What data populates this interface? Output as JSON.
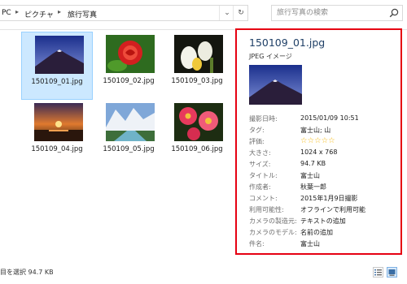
{
  "address_bar": {
    "crumbs": [
      "PC",
      "ピクチャ",
      "旅行写真"
    ],
    "separator": "▸",
    "dropdown_glyph": "⌄",
    "refresh_glyph": "↻"
  },
  "search": {
    "placeholder": "旅行写真の検索",
    "icon": "search-icon"
  },
  "files": [
    {
      "name": "150109_01.jpg",
      "selected": true,
      "thumb": "mountain"
    },
    {
      "name": "150109_02.jpg",
      "selected": false,
      "thumb": "rose"
    },
    {
      "name": "150109_03.jpg",
      "selected": false,
      "thumb": "lilies"
    },
    {
      "name": "150109_04.jpg",
      "selected": false,
      "thumb": "sunset"
    },
    {
      "name": "150109_05.jpg",
      "selected": false,
      "thumb": "valley"
    },
    {
      "name": "150109_06.jpg",
      "selected": false,
      "thumb": "daisies"
    }
  ],
  "details": {
    "title": "150109_01.jpg",
    "file_type": "JPEG イメージ",
    "properties": [
      {
        "label": "撮影日時:",
        "value": "2015/01/09 10:51"
      },
      {
        "label": "タグ:",
        "value": "富士山; 山"
      },
      {
        "label": "評価:",
        "value": "",
        "rating": 0,
        "rating_max": 5
      },
      {
        "label": "大きさ:",
        "value": "1024 x 768"
      },
      {
        "label": "サイズ:",
        "value": "94.7 KB"
      },
      {
        "label": "タイトル:",
        "value": "富士山"
      },
      {
        "label": "作成者:",
        "value": "秋葉一郎"
      },
      {
        "label": "コメント:",
        "value": "2015年1月9日撮影"
      },
      {
        "label": "利用可能性:",
        "value": "オフラインで利用可能"
      },
      {
        "label": "カメラの製造元:",
        "value": "テキストの追加"
      },
      {
        "label": "カメラのモデル:",
        "value": "名前の追加"
      },
      {
        "label": "件名:",
        "value": "富士山"
      }
    ],
    "highlight_color": "#e60012"
  },
  "statusbar": {
    "text": "目を選択  94.7 KB"
  },
  "colors": {
    "selection_bg": "#cce8ff",
    "selection_border": "#99d1ff",
    "star": "#f4b400"
  }
}
